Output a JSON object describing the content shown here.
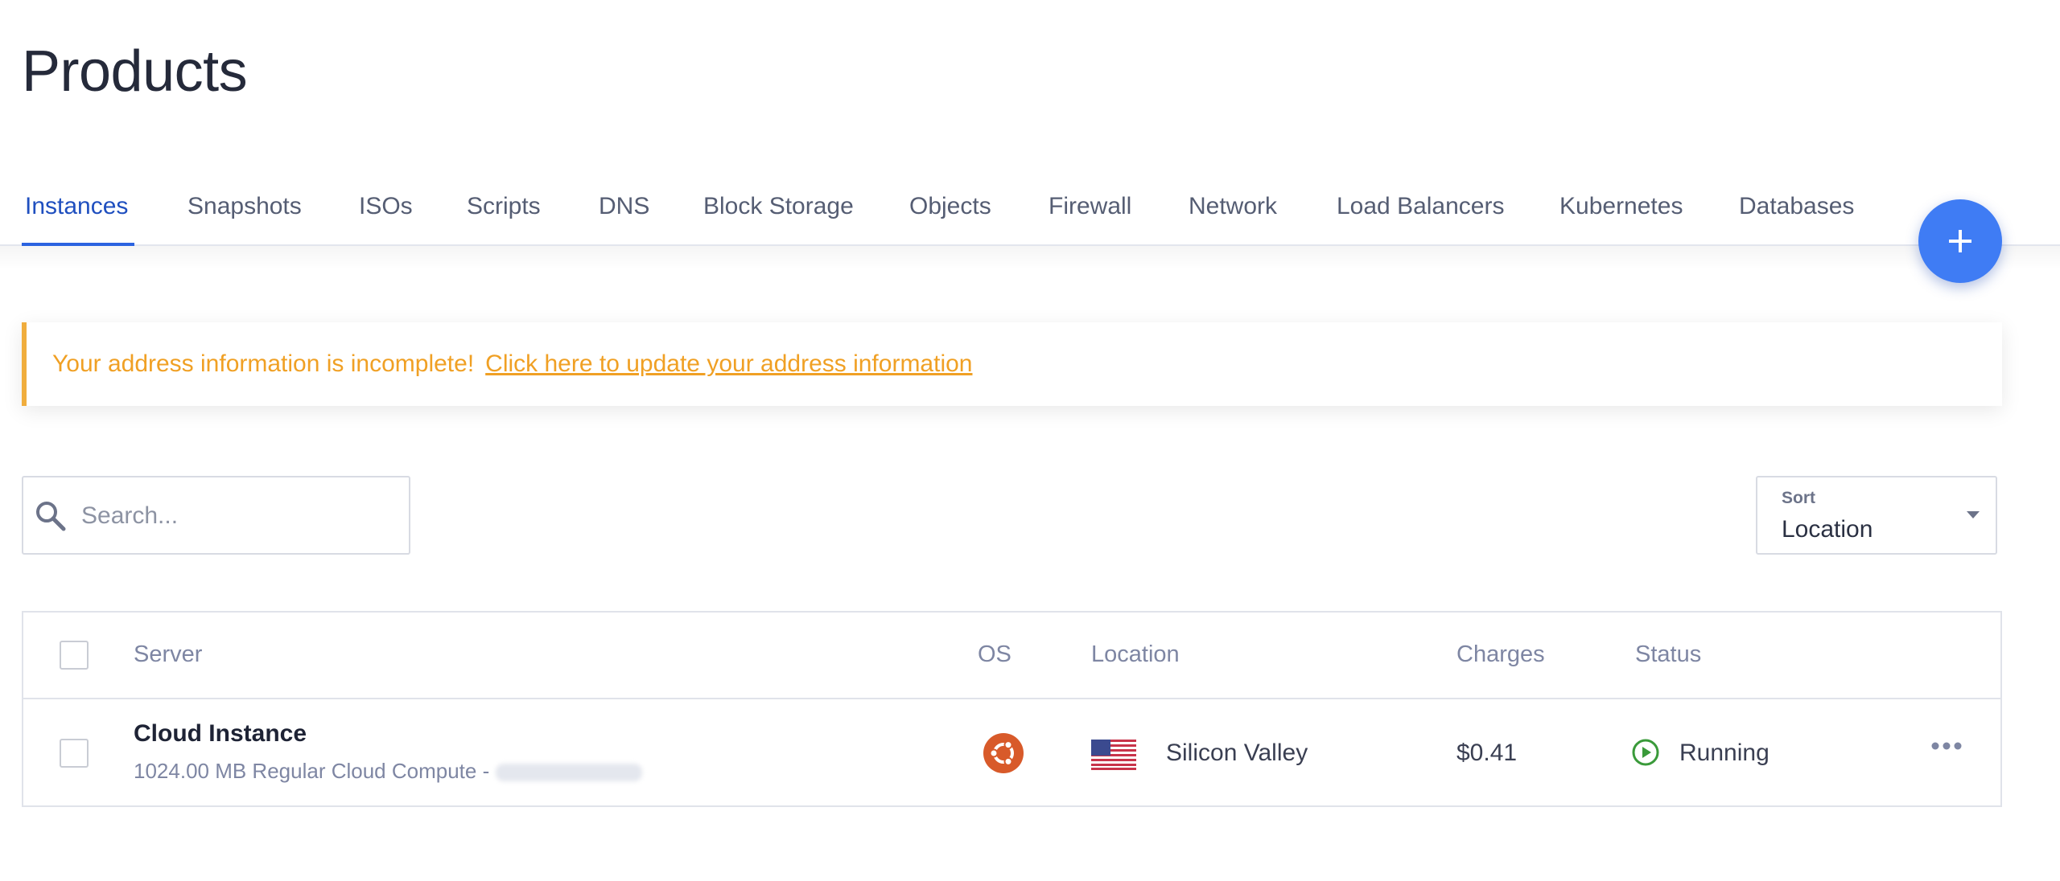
{
  "page": {
    "title": "Products"
  },
  "tabs": [
    {
      "label": "Instances",
      "active": true
    },
    {
      "label": "Snapshots"
    },
    {
      "label": "ISOs"
    },
    {
      "label": "Scripts"
    },
    {
      "label": "DNS"
    },
    {
      "label": "Block Storage"
    },
    {
      "label": "Objects"
    },
    {
      "label": "Firewall"
    },
    {
      "label": "Network"
    },
    {
      "label": "Load Balancers"
    },
    {
      "label": "Kubernetes"
    },
    {
      "label": "Databases"
    }
  ],
  "fab": {
    "icon": "plus-icon",
    "color": "#3f7cf4"
  },
  "alert": {
    "message": "Your address information is incomplete!",
    "link_text": "Click here to update your address information",
    "color": "#f0a024"
  },
  "search": {
    "placeholder": "Search...",
    "value": ""
  },
  "sort": {
    "label": "Sort",
    "value": "Location"
  },
  "table": {
    "columns": {
      "server": "Server",
      "os": "OS",
      "location": "Location",
      "charges": "Charges",
      "status": "Status"
    },
    "rows": [
      {
        "name": "Cloud Instance",
        "description": "1024.00 MB Regular Cloud Compute -",
        "os_icon": "ubuntu-icon",
        "location": "Silicon Valley",
        "location_flag": "us-flag-icon",
        "charges": "$0.41",
        "status": "Running",
        "status_color": "#3a9a3a"
      }
    ]
  },
  "colors": {
    "accent": "#2b63e0",
    "warning": "#f0ad3d",
    "ubuntu": "#d85a2a"
  }
}
